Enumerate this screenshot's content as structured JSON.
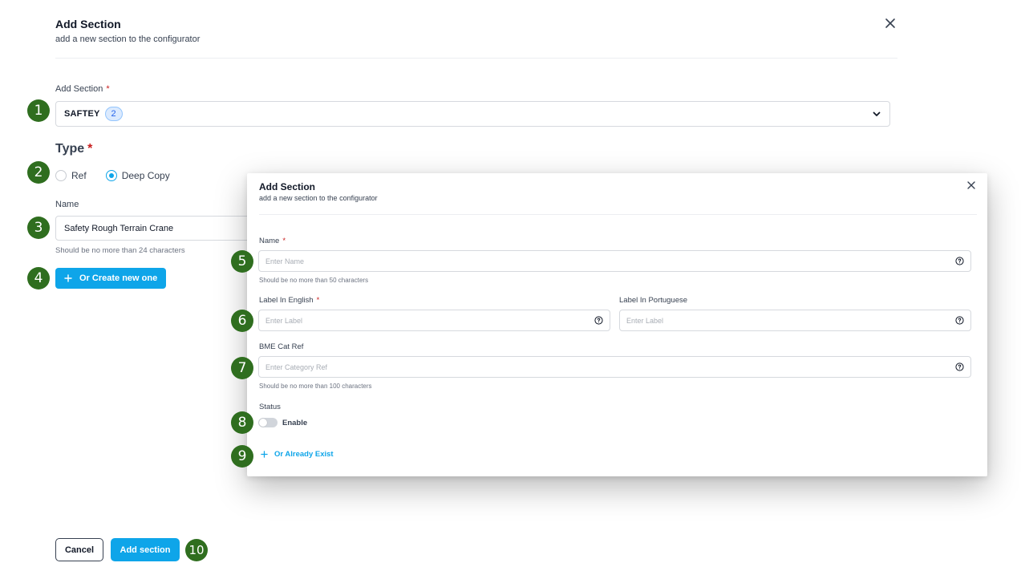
{
  "main": {
    "title": "Add Section",
    "subtitle": "add a new section to the configurator",
    "section_field": {
      "label": "Add Section",
      "required_mark": "*",
      "value": "SAFTEY",
      "count": "2"
    },
    "type": {
      "label": "Type",
      "required_mark": "*",
      "options": [
        "Ref",
        "Deep Copy"
      ],
      "selected": "Deep Copy"
    },
    "name_field": {
      "label": "Name",
      "value": "Safety Rough Terrain Crane",
      "hint": "Should be no more than 24 characters"
    },
    "create_button": "Or Create new one",
    "cancel_button": "Cancel",
    "add_button": "Add section"
  },
  "modal": {
    "title": "Add Section",
    "subtitle": "add a new section to the configurator",
    "name": {
      "label": "Name",
      "required_mark": "*",
      "placeholder": "Enter Name",
      "hint": "Should be no more than 50 characters"
    },
    "label_english": {
      "label": "Label In English",
      "required_mark": "*",
      "placeholder": "Enter Label"
    },
    "label_portuguese": {
      "label": "Label In Portuguese",
      "placeholder": "Enter Label"
    },
    "bme_cat_ref": {
      "label": "BME Cat Ref",
      "placeholder": "Enter Category Ref",
      "hint": "Should be no more than 100 characters"
    },
    "status": {
      "label": "Status",
      "toggle_label": "Enable"
    },
    "exist_link": "Or Already Exist"
  },
  "markers": [
    "1",
    "2",
    "3",
    "4",
    "5",
    "6",
    "7",
    "8",
    "9",
    "10"
  ],
  "colors": {
    "accent": "#0ea5e9",
    "marker": "#2f6e1f",
    "required": "#c81e1e"
  }
}
